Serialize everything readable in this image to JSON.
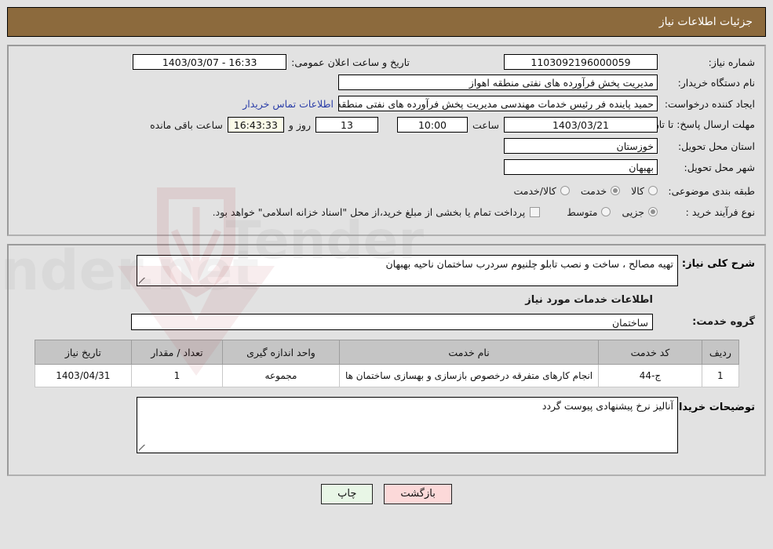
{
  "header": {
    "title": "جزئیات اطلاعات نیاز"
  },
  "colors": {
    "header_bg": "#8c6a3d",
    "page_bg": "#e2e2e2",
    "link": "#2b3ea8",
    "table_header_bg": "#c5c5c5",
    "print_button_bg": "#e8f6e6",
    "back_button_bg": "#fcd9d9",
    "countdown_bg": "#fbfbe8"
  },
  "form": {
    "need_number": {
      "label": "شماره نیاز:",
      "value": "1103092196000059"
    },
    "public_announce": {
      "label": "تاریخ و ساعت اعلان عمومی:",
      "value": "16:33 - 1403/03/07"
    },
    "buyer_org": {
      "label": "نام دستگاه خریدار:",
      "value": "مدیریت پخش فرآورده های نفتی منطقه اهواز"
    },
    "request_creator": {
      "label": "ایجاد کننده درخواست:",
      "value": "حمید پاینده فر رئیس خدمات مهندسی مدیریت پخش فرآورده های نفتی منطقه ا"
    },
    "buyer_contact_link": "اطلاعات تماس خریدار",
    "deadline": {
      "label": "مهلت ارسال پاسخ: تا تاریخ:",
      "date": "1403/03/21",
      "hour_label": "ساعت",
      "hour": "10:00",
      "days": "13",
      "days_suffix": "روز و",
      "remaining": "16:43:33",
      "remaining_suffix": "ساعت باقی مانده"
    },
    "delivery_province": {
      "label": "استان محل تحویل:",
      "value": "خوزستان"
    },
    "delivery_city": {
      "label": "شهر محل تحویل:",
      "value": "بهبهان"
    },
    "subject_classification": {
      "label": "طبقه بندی موضوعی:",
      "options": [
        "کالا",
        "خدمت",
        "کالا/خدمت"
      ],
      "selected": "خدمت"
    },
    "purchase_process": {
      "label": "نوع فرآیند خرید :",
      "options": [
        "جزیی",
        "متوسط"
      ],
      "selected": "جزیی"
    },
    "treasury_note": {
      "text": "پرداخت تمام یا بخشی از مبلغ خرید،از محل \"اسناد خزانه اسلامی\" خواهد بود.",
      "checked": false
    }
  },
  "details": {
    "general_description": {
      "label": "شرح کلی نیاز:",
      "value": "تهیه مصالح ، ساخت و نصب تابلو چلنیوم سردرب ساختمان ناحیه بهبهان"
    },
    "services_section_title": "اطلاعات خدمات مورد نیاز",
    "service_group": {
      "label": "گروه خدمت:",
      "value": "ساختمان"
    },
    "table": {
      "columns": [
        "ردیف",
        "کد خدمت",
        "نام خدمت",
        "واحد اندازه گیری",
        "تعداد / مقدار",
        "تاریخ نیاز"
      ],
      "rows": [
        {
          "radif": "1",
          "code": "ج-44",
          "name": "انجام کارهای متفرقه درخصوص بازسازی و بهسازی ساختمان ها",
          "unit": "مجموعه",
          "qty": "1",
          "date": "1403/04/31"
        }
      ]
    },
    "buyer_comments": {
      "label": "توضیحات خریدار:",
      "value": "آنالیز نرخ پیشنهادی پیوست گردد"
    }
  },
  "footer": {
    "print_label": "چاپ",
    "back_label": "بازگشت"
  },
  "watermark": {
    "text": "AriaTender.net"
  }
}
